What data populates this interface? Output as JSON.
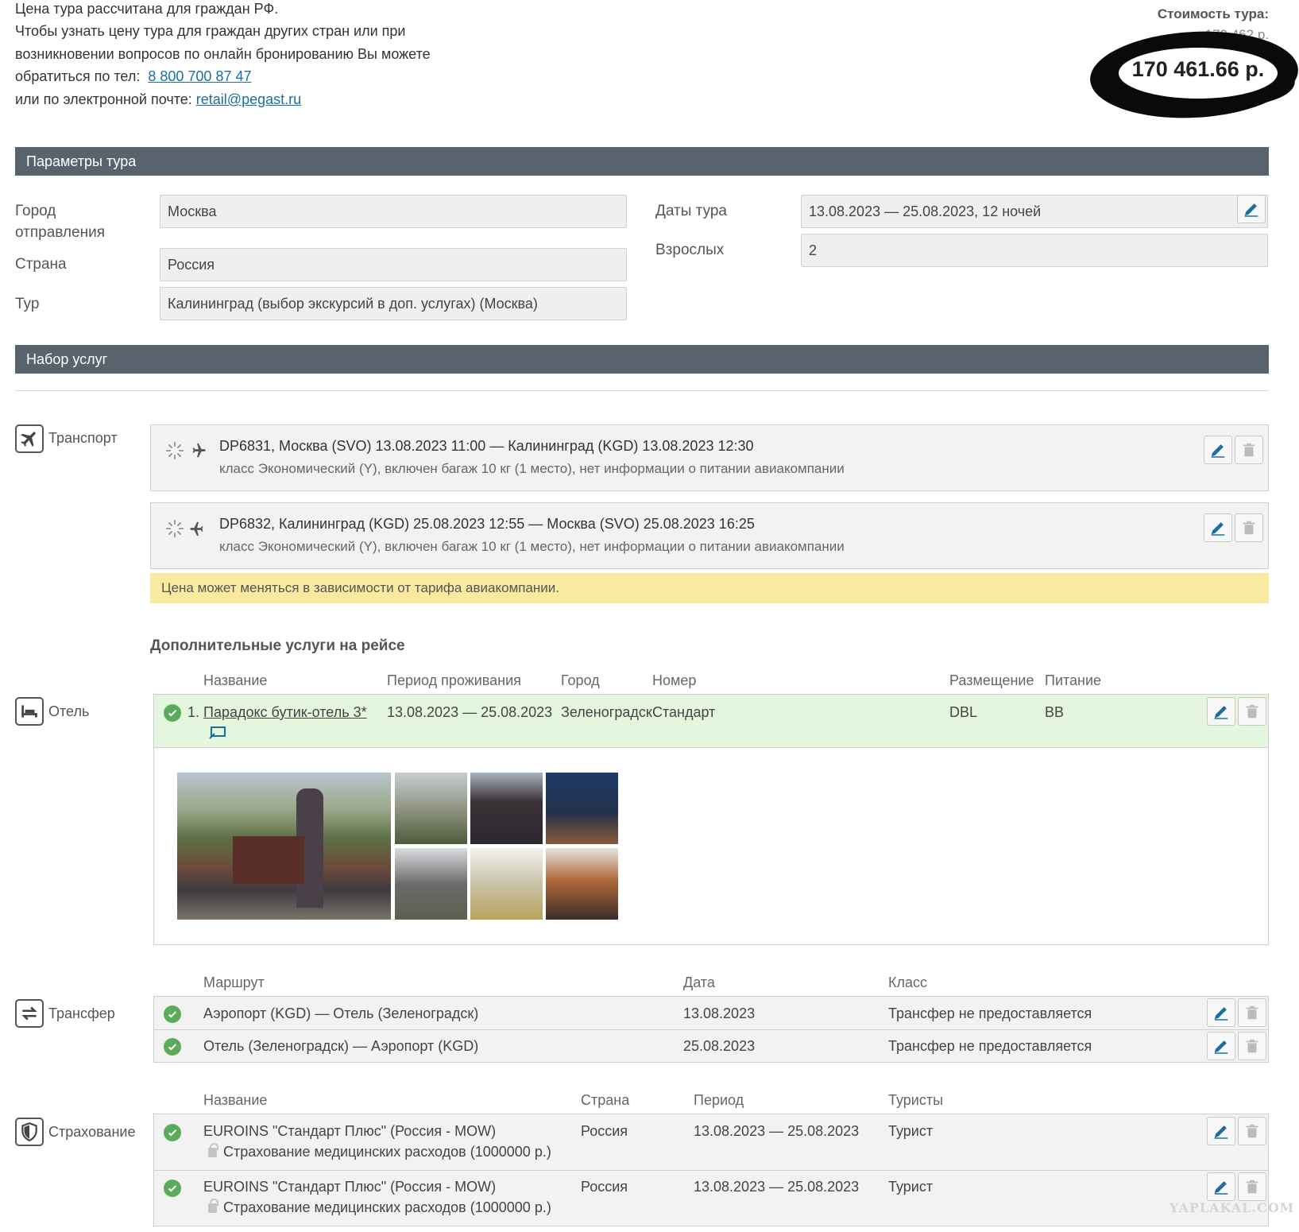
{
  "info": {
    "line1": "Цена тура рассчитана для граждан РФ.",
    "line2": "Чтобы узнать цену тура для граждан других стран или при",
    "line3": "возникновении вопросов по онлайн бронированию Вы можете",
    "line4_prefix": "обратиться по тел:",
    "phone": "8 800 700 87 47",
    "line5_prefix": "или по электронной почте:",
    "email": "retail@pegast.ru"
  },
  "price": {
    "label": "Стоимость тура:",
    "old_value": "170 462 р.",
    "value": "170 461.66 р."
  },
  "tour_params": {
    "title": "Параметры тура",
    "departure_label": "Город отправления",
    "departure_value": "Москва",
    "country_label": "Страна",
    "country_value": "Россия",
    "tour_label": "Тур",
    "tour_value": "Калининград (выбор экскурсий в доп. услугах) (Москва)",
    "dates_label": "Даты тура",
    "dates_value": "13.08.2023 — 25.08.2023, 12  ночей",
    "adults_label": "Взрослых",
    "adults_value": "2"
  },
  "services": {
    "title": "Набор услуг",
    "transport": {
      "label": "Транспорт",
      "flights": [
        {
          "main": "DP6831, Москва (SVO) 13.08.2023 11:00 — Калининград (KGD) 13.08.2023 12:30",
          "sub": "класс Экономический (Y), включен багаж 10 кг (1 место), нет информации о питании авиакомпании"
        },
        {
          "main": "DP6832, Калининград (KGD) 25.08.2023 12:55 — Москва (SVO) 25.08.2023 16:25",
          "sub": "класс Экономический (Y), включен багаж 10 кг (1 место), нет информации о питании авиакомпании"
        }
      ],
      "notice": "Цена может меняться в зависимости от тарифа авиакомпании.",
      "extra_heading": "Дополнительные услуги на рейсе"
    },
    "hotel": {
      "label": "Отель",
      "headers": {
        "name": "Название",
        "period": "Период проживания",
        "city": "Город",
        "room": "Номер",
        "placement": "Размещение",
        "meal": "Питание"
      },
      "row": {
        "num": "1.",
        "name": "Парадокс бутик-отель 3*",
        "period": "13.08.2023 — 25.08.2023",
        "city": "Зеленоградск",
        "room": "Стандарт",
        "placement": "DBL",
        "meal": "BB"
      }
    },
    "transfer": {
      "label": "Трансфер",
      "headers": {
        "route": "Маршрут",
        "date": "Дата",
        "class": "Класс"
      },
      "rows": [
        {
          "route": "Аэропорт (KGD) — Отель (Зеленоградск)",
          "date": "13.08.2023",
          "class": "Трансфер не предоставляется"
        },
        {
          "route": "Отель (Зеленоградск) — Аэропорт (KGD)",
          "date": "25.08.2023",
          "class": "Трансфер не предоставляется"
        }
      ]
    },
    "insurance": {
      "label": "Страхование",
      "headers": {
        "name": "Название",
        "country": "Страна",
        "period": "Период",
        "tourists": "Туристы"
      },
      "rows": [
        {
          "name": "EUROINS \"Стандарт Плюс\" (Россия - MOW)",
          "detail": "Страхование медицинских расходов (1000000 р.)",
          "country": "Россия",
          "period": "13.08.2023 — 25.08.2023",
          "tourists": "Турист"
        },
        {
          "name": "EUROINS \"Стандарт Плюс\" (Россия - MOW)",
          "detail": "Страхование медицинских расходов (1000000 р.)",
          "country": "Россия",
          "period": "13.08.2023 — 25.08.2023",
          "tourists": "Турист"
        }
      ]
    }
  },
  "watermark": "YAPLAKAL.COM",
  "colors": {
    "section_bar": "#58636d",
    "link": "#1a6ea0",
    "notice_bg": "#faeaa0",
    "hotel_row_bg": "#e4f7de",
    "check_green": "#5cab5a",
    "edit_blue": "#1a6ea0"
  }
}
